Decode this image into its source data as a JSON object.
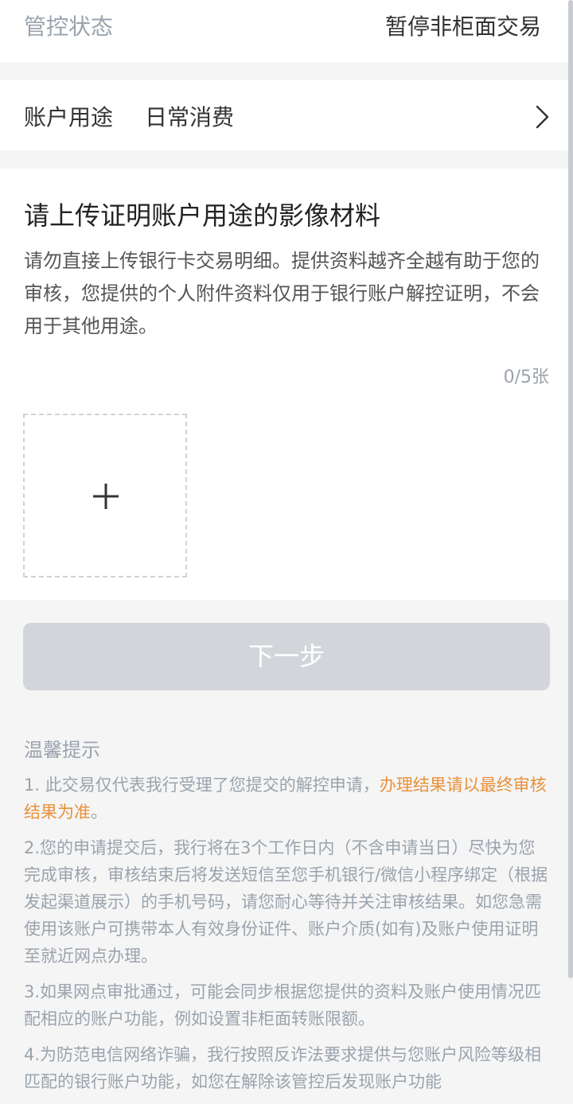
{
  "status": {
    "label": "管控状态",
    "value": "暂停非柜面交易"
  },
  "purpose": {
    "label": "账户用途",
    "value": "日常消费",
    "chevron_icon": "chevron-right-icon"
  },
  "upload": {
    "title": "请上传证明账户用途的影像材料",
    "description": "请勿直接上传银行卡交易明细。提供资料越齐全越有助于您的审核，您提供的个人附件资料仅用于银行账户解控证明，不会用于其他用途。",
    "count": "0/5张",
    "add_icon": "plus-icon"
  },
  "next_button": {
    "label": "下一步"
  },
  "tips": {
    "title": "温馨提示",
    "items": [
      {
        "text": "1. 此交易仅代表我行受理了您提交的解控申请，",
        "highlight": "办理结果请以最终审核结果为准",
        "suffix": "。"
      },
      {
        "text": "2.您的申请提交后，我行将在3个工作日内（不含申请当日）尽快为您完成审核，审核结束后将发送短信至您手机银行/微信小程序绑定（根据发起渠道展示）的手机号码，请您耐心等待并关注审核结果。如您急需使用该账户可携带本人有效身份证件、账户介质(如有)及账户使用证明至就近网点办理。"
      },
      {
        "text": "3.如果网点审批通过，可能会同步根据您提供的资料及账户使用情况匹配相应的账户功能，例如设置非柜面转账限额。"
      },
      {
        "text": "4.为防范电信网络诈骗，我行按照反诈法要求提供与您账户风险等级相匹配的银行账户功能，如您在解除该管控后发现账户功能"
      }
    ]
  },
  "colors": {
    "background": "#f5f5f5",
    "card": "#ffffff",
    "muted_text": "#9aa3ad",
    "highlight": "#e8913a",
    "disabled_button": "#d2d5da"
  }
}
